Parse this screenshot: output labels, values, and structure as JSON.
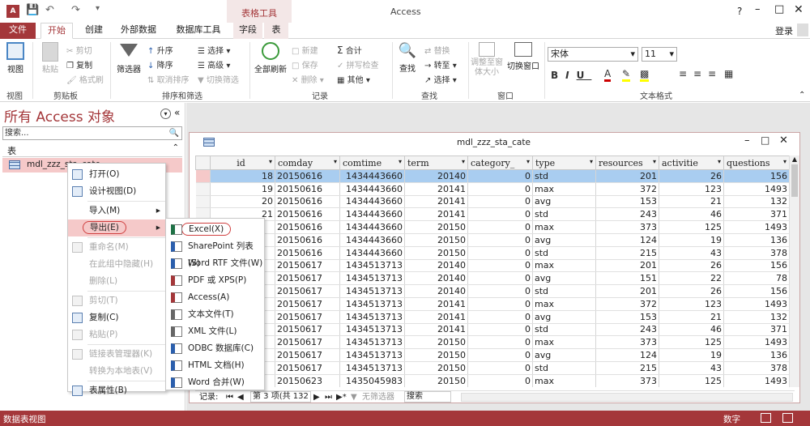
{
  "app": {
    "title": "Access",
    "table_tools": "表格工具",
    "help": "?",
    "login": "登录",
    "accent": "#a4373a"
  },
  "tabs": [
    "文件",
    "开始",
    "创建",
    "外部数据",
    "数据库工具",
    "字段",
    "表"
  ],
  "ribbon": {
    "view": "视图",
    "view_group": "视图",
    "paste": "粘贴",
    "cut": "剪切",
    "copy": "复制",
    "painter": "格式刷",
    "clipboard_group": "剪贴板",
    "filter": "筛选器",
    "asc": "升序",
    "desc": "降序",
    "clear_sort": "取消排序",
    "select": "选择",
    "advanced": "高级",
    "toggle_filter": "切换筛选",
    "sort_group": "排序和筛选",
    "refresh": "全部刷新",
    "new": "新建",
    "save": "保存",
    "delete": "删除",
    "totals": "合计",
    "spell": "拼写检查",
    "more": "其他",
    "records_group": "记录",
    "find": "查找",
    "replace": "替换",
    "goto": "转至",
    "select2": "选择",
    "find_group": "查找",
    "resize": "调整至窗体大小",
    "switch_window": "切换窗口",
    "window_group": "窗口",
    "font": "宋体",
    "size": "11",
    "text_group": "文本格式"
  },
  "nav": {
    "title": "所有 Access 对象",
    "search_placeholder": "搜索...",
    "section": "表",
    "table_name": "mdl_zzz_sta_cate"
  },
  "context_menu": [
    {
      "label": "打开(O)",
      "icon": "open-icon",
      "enabled": true
    },
    {
      "label": "设计视图(D)",
      "icon": "design-icon",
      "enabled": true
    },
    {
      "label": "导入(M)",
      "icon": "",
      "enabled": true,
      "arrow": true
    },
    {
      "label": "导出(E)",
      "icon": "",
      "enabled": true,
      "arrow": true,
      "active": true
    },
    {
      "label": "重命名(M)",
      "icon": "rename-icon",
      "enabled": false
    },
    {
      "label": "在此组中隐藏(H)",
      "icon": "",
      "enabled": false
    },
    {
      "label": "删除(L)",
      "icon": "",
      "enabled": false
    },
    {
      "label": "剪切(T)",
      "icon": "cut-icon",
      "enabled": false
    },
    {
      "label": "复制(C)",
      "icon": "copy-icon",
      "enabled": true
    },
    {
      "label": "粘贴(P)",
      "icon": "paste-icon",
      "enabled": false
    },
    {
      "label": "链接表管理器(K)",
      "icon": "link-icon",
      "enabled": false
    },
    {
      "label": "转换为本地表(V)",
      "icon": "",
      "enabled": false
    },
    {
      "label": "表属性(B)",
      "icon": "properties-icon",
      "enabled": true
    }
  ],
  "export_menu": [
    "Excel(X)",
    "SharePoint 列表(S)",
    "Word RTF 文件(W)",
    "PDF 或 XPS(P)",
    "Access(A)",
    "文本文件(T)",
    "XML 文件(L)",
    "ODBC 数据库(C)",
    "HTML 文档(H)",
    "Word 合并(W)"
  ],
  "datasheet": {
    "title": "mdl_zzz_sta_cate",
    "columns": [
      "id",
      "comday",
      "comtime",
      "term",
      "category_",
      "type",
      "resources",
      "activitie",
      "questions"
    ],
    "rows": [
      [
        "18",
        "20150616",
        "1434443660",
        "20140",
        "0",
        "std",
        "201",
        "26",
        "156"
      ],
      [
        "19",
        "20150616",
        "1434443660",
        "20141",
        "0",
        "max",
        "372",
        "123",
        "1493"
      ],
      [
        "20",
        "20150616",
        "1434443660",
        "20141",
        "0",
        "avg",
        "153",
        "21",
        "132"
      ],
      [
        "21",
        "20150616",
        "1434443660",
        "20141",
        "0",
        "std",
        "243",
        "46",
        "371"
      ],
      [
        "",
        "20150616",
        "1434443660",
        "20150",
        "0",
        "max",
        "373",
        "125",
        "1493"
      ],
      [
        "",
        "20150616",
        "1434443660",
        "20150",
        "0",
        "avg",
        "124",
        "19",
        "136"
      ],
      [
        "",
        "20150616",
        "1434443660",
        "20150",
        "0",
        "std",
        "215",
        "43",
        "378"
      ],
      [
        "",
        "20150617",
        "1434513713",
        "20140",
        "0",
        "max",
        "201",
        "26",
        "156"
      ],
      [
        "",
        "20150617",
        "1434513713",
        "20140",
        "0",
        "avg",
        "151",
        "22",
        "78"
      ],
      [
        "",
        "20150617",
        "1434513713",
        "20140",
        "0",
        "std",
        "201",
        "26",
        "156"
      ],
      [
        "",
        "20150617",
        "1434513713",
        "20141",
        "0",
        "max",
        "372",
        "123",
        "1493"
      ],
      [
        "",
        "20150617",
        "1434513713",
        "20141",
        "0",
        "avg",
        "153",
        "21",
        "132"
      ],
      [
        "",
        "20150617",
        "1434513713",
        "20141",
        "0",
        "std",
        "243",
        "46",
        "371"
      ],
      [
        "",
        "20150617",
        "1434513713",
        "20150",
        "0",
        "max",
        "373",
        "125",
        "1493"
      ],
      [
        "",
        "20150617",
        "1434513713",
        "20150",
        "0",
        "avg",
        "124",
        "19",
        "136"
      ],
      [
        "",
        "20150617",
        "1434513713",
        "20150",
        "0",
        "std",
        "215",
        "43",
        "378"
      ],
      [
        "",
        "20150623",
        "1435045983",
        "20150",
        "0",
        "max",
        "373",
        "125",
        "1493"
      ]
    ],
    "record_label": "记录:",
    "record_pos": "第 3 项(共 132",
    "no_filter": "无筛选器",
    "search": "搜索"
  },
  "status": {
    "left": "数据表视图",
    "right": "数字"
  }
}
